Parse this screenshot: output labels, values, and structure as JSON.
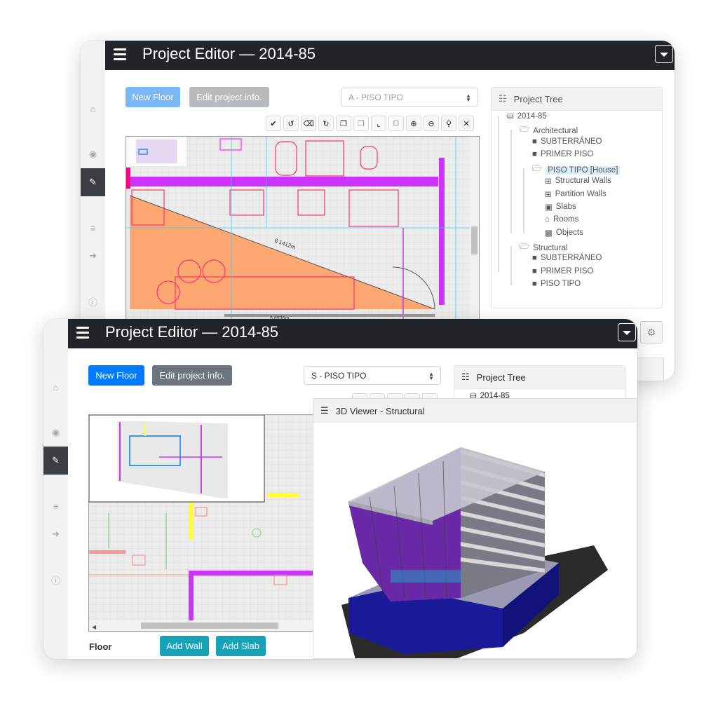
{
  "back": {
    "title": "Project Editor — 2014-85",
    "new_floor": "New Floor",
    "edit_info": "Edit project info.",
    "floor_select": "A - PISO TIPO",
    "tree_title": "Project Tree",
    "dimension_1": "6.1412m",
    "dimension_2": "5.8936m",
    "tree": [
      {
        "label": "2014-85",
        "icon": "database-icon"
      },
      {
        "label": "Architectural",
        "icon": "folder-open-icon"
      },
      {
        "label": "SUBTERRÁNEO",
        "icon": "folder-icon"
      },
      {
        "label": "PRIMER PISO",
        "icon": "folder-icon"
      },
      {
        "label": "PISO TIPO [House]",
        "icon": "folder-open-icon"
      },
      {
        "label": "Structural Walls",
        "icon": "plus-square-icon"
      },
      {
        "label": "Partition Walls",
        "icon": "plus-square-icon"
      },
      {
        "label": "Slabs",
        "icon": "slab-icon"
      },
      {
        "label": "Rooms",
        "icon": "house-icon"
      },
      {
        "label": "Objects",
        "icon": "couch-icon"
      },
      {
        "label": "Structural",
        "icon": "folder-open-icon"
      },
      {
        "label": "SUBTERRÁNEO",
        "icon": "folder-icon"
      },
      {
        "label": "PRIMER PISO",
        "icon": "folder-icon"
      },
      {
        "label": "PISO TIPO",
        "icon": "folder-icon"
      }
    ]
  },
  "front": {
    "title": "Project Editor — 2014-85",
    "new_floor": "New Floor",
    "edit_info": "Edit project info.",
    "floor_select": "S - PISO TIPO",
    "tree_title": "Project Tree",
    "tree_root": "2014-85",
    "viewer_title": "3D Viewer - Structural",
    "floor_label": "Floor",
    "add_wall": "Add Wall",
    "add_slab": "Add Slab"
  },
  "colors": {
    "topbar": "#212529",
    "primary": "#007bff",
    "primary_light": "#7ab8f5",
    "secondary": "#6c757d",
    "secondary_light": "#b8bbbe",
    "teal": "#17a2b8",
    "wall_magenta": "#cc33ff",
    "fill_orange": "#ffa066"
  }
}
